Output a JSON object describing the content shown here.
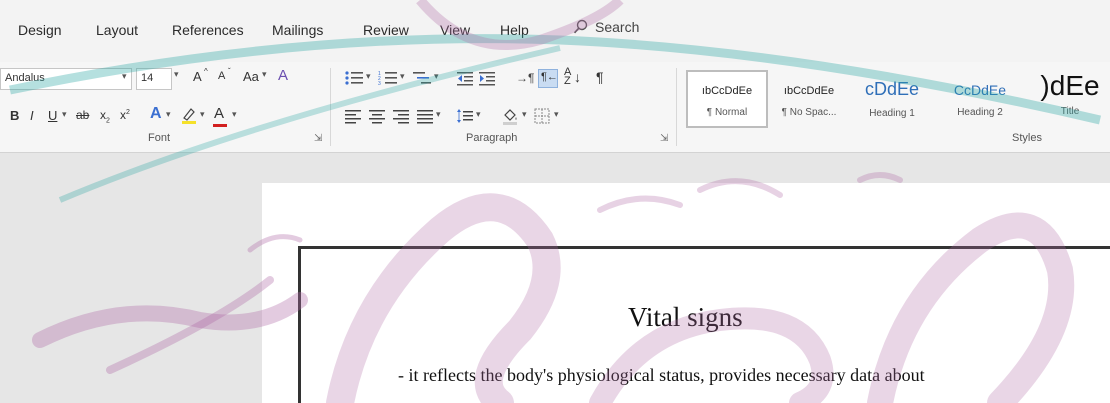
{
  "tabs": [
    "Design",
    "Layout",
    "References",
    "Mailings",
    "Review",
    "View",
    "Help"
  ],
  "search": {
    "label": "Search"
  },
  "font": {
    "name": "Andalus",
    "size": "14",
    "grow": "A",
    "shrink": "A",
    "change_case": "Aa",
    "bold": "B",
    "italic": "I",
    "underline": "U",
    "strike": "ab",
    "subscript": "x",
    "superscript": "x",
    "color_letter": "A",
    "group_label": "Font"
  },
  "paragraph": {
    "group_label": "Paragraph"
  },
  "styles": {
    "items": [
      {
        "preview": "ıbCcDdEe",
        "name": "¶ Normal"
      },
      {
        "preview": "ıbCcDdEe",
        "name": "¶ No Spac..."
      },
      {
        "preview": "cDdEe",
        "name": "Heading 1"
      },
      {
        "preview": "CcDdEe",
        "name": "Heading 2"
      },
      {
        "preview": ")dEe",
        "name": "Title"
      }
    ],
    "group_label": "Styles"
  },
  "document": {
    "title": "Vital signs",
    "line1": "- it reflects the body's physiological status, provides necessary data about"
  },
  "colors": {
    "watermark": "#b06aa6",
    "teal": "#2ca7a3",
    "font_color": "#d21f1f",
    "highlight": "#f5e12a"
  }
}
